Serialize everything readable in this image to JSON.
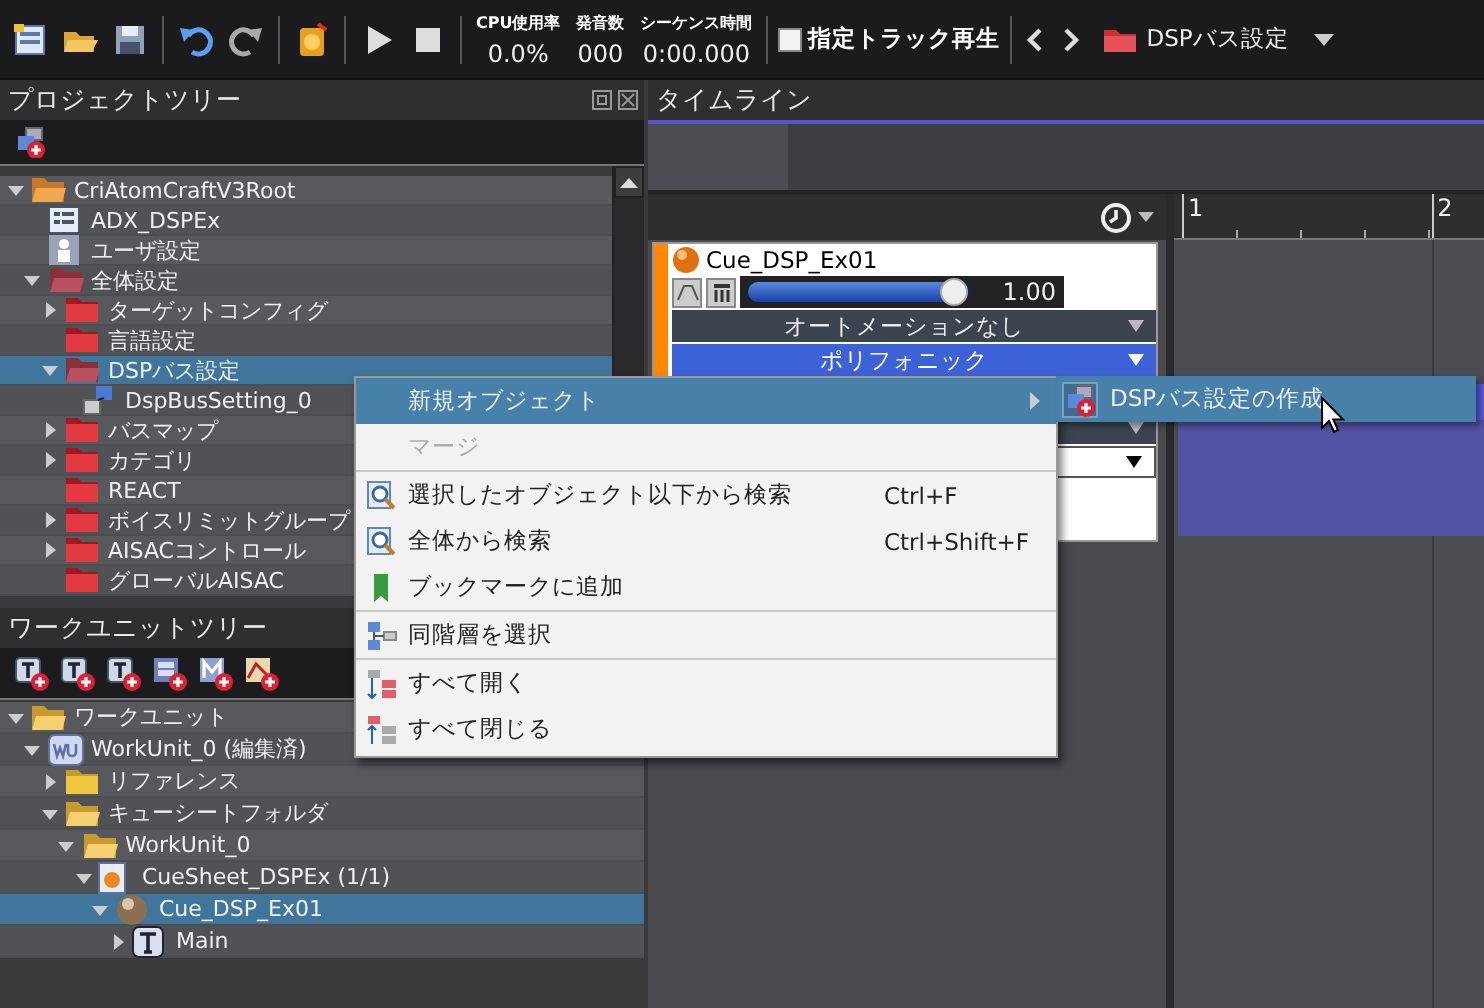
{
  "toolbar": {
    "monitor": [
      {
        "label": "CPU使用率",
        "value": "0.0%"
      },
      {
        "label": "発音数",
        "value": "000"
      },
      {
        "label": "シーケンス時間",
        "value": "0:00.000"
      }
    ],
    "track_play": {
      "label": "指定トラック再生",
      "checked": false
    },
    "current": {
      "label": "DSPバス設定"
    }
  },
  "project_tree": {
    "title": "プロジェクトツリー",
    "items": [
      {
        "label": "CriAtomCraftV3Root",
        "kind": "root-folder",
        "expanded": true,
        "selected": false,
        "children": [
          {
            "label": "ADX_DSPEx",
            "kind": "project",
            "selected": false
          },
          {
            "label": "ユーザ設定",
            "kind": "user",
            "selected": false
          },
          {
            "label": "全体設定",
            "kind": "settings-folder",
            "expanded": true,
            "selected": false,
            "children": [
              {
                "label": "ターゲットコンフィグ",
                "kind": "settings-folder",
                "expanded": false,
                "selected": false
              },
              {
                "label": "言語設定",
                "kind": "settings-folder",
                "selected": false
              },
              {
                "label": "DSPバス設定",
                "kind": "settings-folder",
                "expanded": true,
                "selected": true,
                "children": [
                  {
                    "label": "DspBusSetting_0",
                    "kind": "dsp-setting",
                    "selected": false
                  }
                ]
              },
              {
                "label": "バスマップ",
                "kind": "settings-folder",
                "expanded": false,
                "selected": false
              },
              {
                "label": "カテゴリ",
                "kind": "settings-folder",
                "expanded": false,
                "selected": false
              },
              {
                "label": "REACT",
                "kind": "settings-folder",
                "selected": false
              },
              {
                "label": "ボイスリミットグループ",
                "kind": "settings-folder",
                "expanded": false,
                "selected": false
              },
              {
                "label": "AISACコントロール",
                "kind": "settings-folder",
                "expanded": false,
                "selected": false
              },
              {
                "label": "グローバルAISAC",
                "kind": "settings-folder",
                "selected": false
              }
            ]
          }
        ]
      }
    ]
  },
  "workunit_tree": {
    "title": "ワークユニットツリー",
    "items": [
      {
        "label": "ワークユニット",
        "kind": "folder",
        "expanded": true,
        "selected": false,
        "children": [
          {
            "label": "WorkUnit_0 (編集済)",
            "kind": "workunit",
            "expanded": true,
            "selected": false,
            "children": [
              {
                "label": "リファレンス",
                "kind": "folder",
                "expanded": false,
                "selected": false
              },
              {
                "label": "キューシートフォルダ",
                "kind": "folder",
                "expanded": true,
                "selected": false,
                "children": [
                  {
                    "label": "WorkUnit_0",
                    "kind": "folder",
                    "expanded": true,
                    "selected": false,
                    "children": [
                      {
                        "label": "CueSheet_DSPEx (1/1)",
                        "kind": "cuesheet",
                        "expanded": true,
                        "selected": false,
                        "children": [
                          {
                            "label": "Cue_DSP_Ex01",
                            "kind": "cue",
                            "expanded": true,
                            "selected": true,
                            "children": [
                              {
                                "label": "Main",
                                "kind": "track",
                                "expanded": false,
                                "selected": false
                              }
                            ]
                          }
                        ]
                      }
                    ]
                  }
                ]
              }
            ]
          }
        ]
      }
    ]
  },
  "timeline": {
    "title": "タイムライン",
    "ruler": [
      "1",
      "2"
    ],
    "track": {
      "name": "Cue_DSP_Ex01",
      "color": "#ff8800",
      "level": 0.94,
      "reading": "1.00",
      "automation": "オートメーションなし",
      "mode": "ポリフォニック"
    }
  },
  "context_menu": {
    "items": [
      {
        "kind": "item",
        "label": "新規オブジェクト",
        "selected": true,
        "disabled": false,
        "submenu": true
      },
      {
        "kind": "item",
        "label": "マージ",
        "selected": false,
        "disabled": true,
        "submenu": false
      },
      {
        "kind": "separator"
      },
      {
        "kind": "item",
        "label": "選択したオブジェクト以下から検索",
        "shortcut": "Ctrl+F",
        "selected": false,
        "disabled": false,
        "submenu": false
      },
      {
        "kind": "item",
        "label": "全体から検索",
        "shortcut": "Ctrl+Shift+F",
        "selected": false,
        "disabled": false,
        "submenu": false
      },
      {
        "kind": "item",
        "label": "ブックマークに追加",
        "selected": false,
        "disabled": false,
        "submenu": false
      },
      {
        "kind": "separator"
      },
      {
        "kind": "item",
        "label": "同階層を選択",
        "selected": false,
        "disabled": false,
        "submenu": false
      },
      {
        "kind": "separator"
      },
      {
        "kind": "item",
        "label": "すべて開く",
        "selected": false,
        "disabled": false,
        "submenu": false
      },
      {
        "kind": "item",
        "label": "すべて閉じる",
        "selected": false,
        "disabled": false,
        "submenu": false
      }
    ],
    "submenu": [
      {
        "label": "DSPバス設定の作成",
        "selected": true
      }
    ]
  }
}
